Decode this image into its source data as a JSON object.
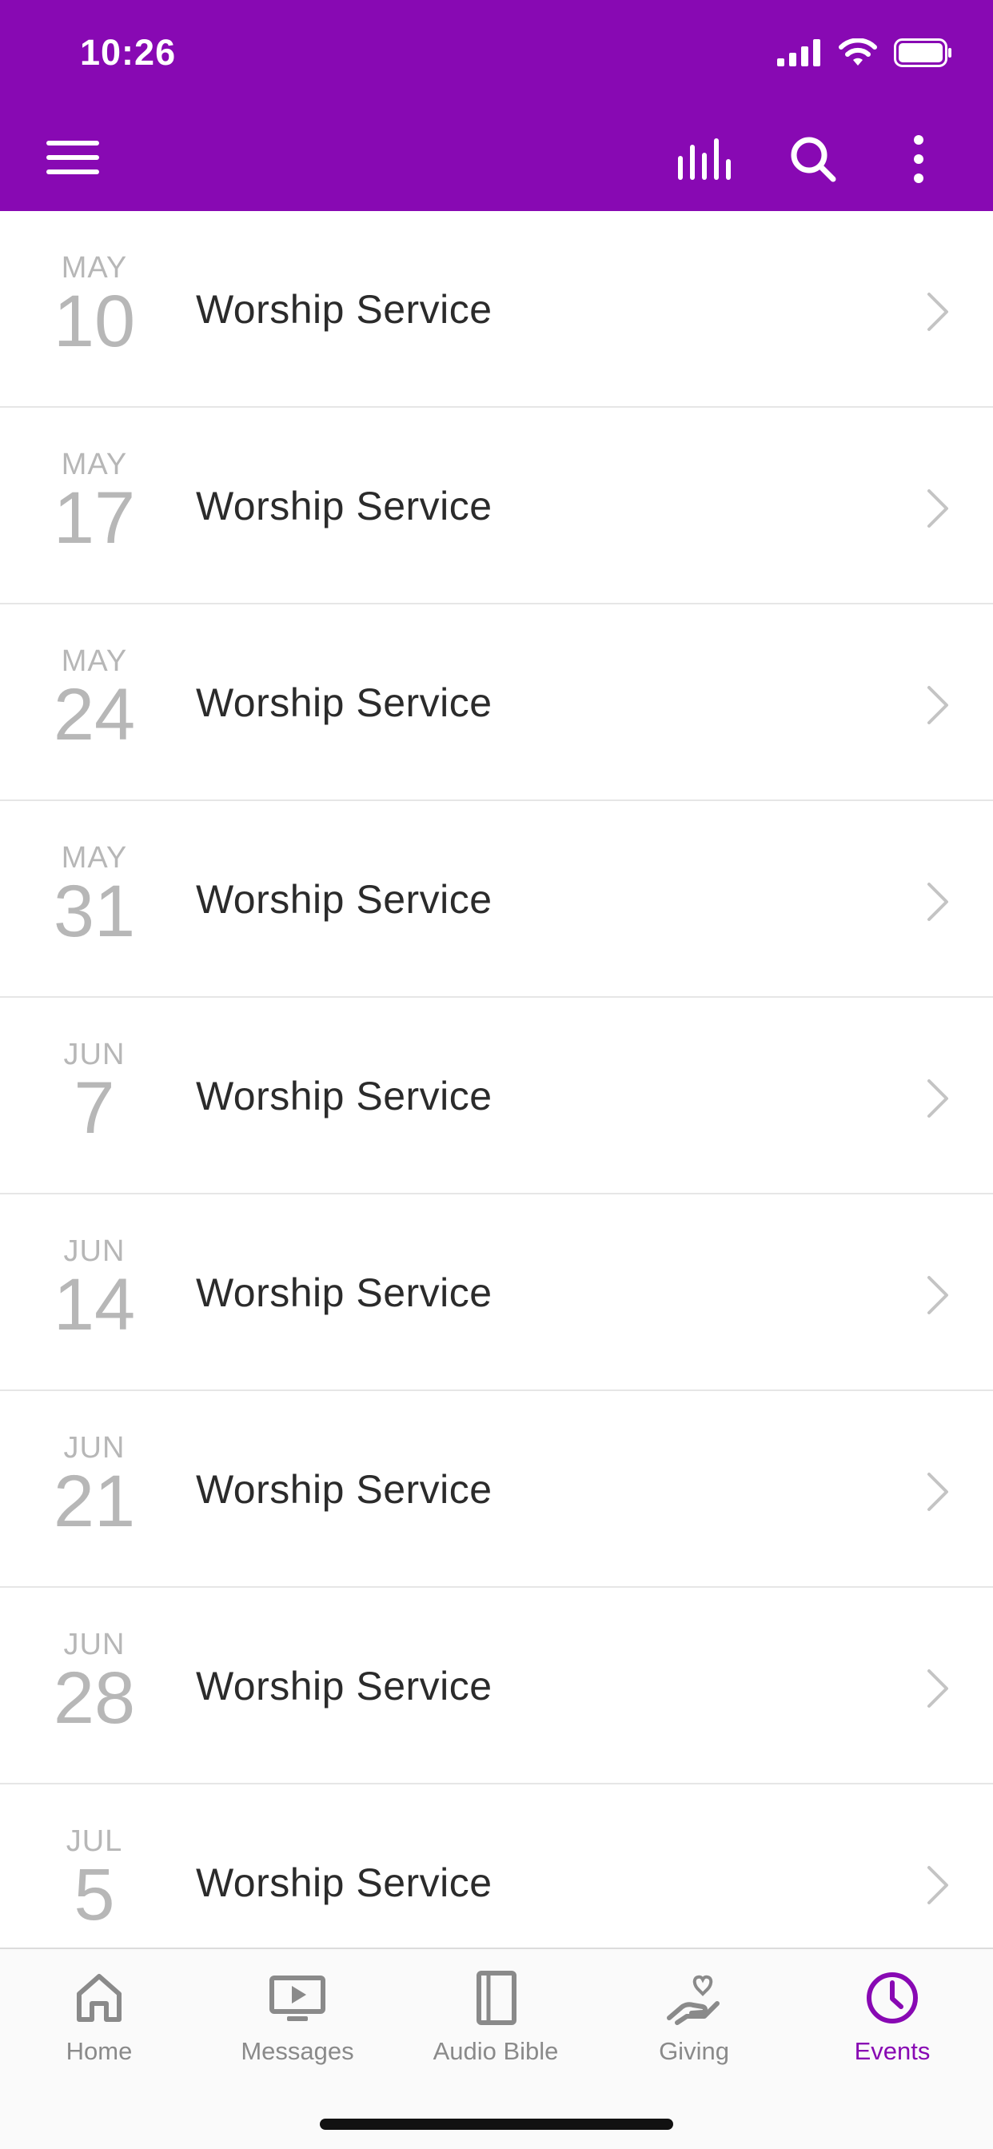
{
  "status_bar": {
    "time": "10:26"
  },
  "colors": {
    "brand": "#8809b3",
    "date_text": "#b7b7b7",
    "title_text": "#2b2b2b",
    "tab_inactive": "#8a8a8a"
  },
  "events": [
    {
      "month": "MAY",
      "day": "10",
      "title": "Worship Service"
    },
    {
      "month": "MAY",
      "day": "17",
      "title": "Worship Service"
    },
    {
      "month": "MAY",
      "day": "24",
      "title": "Worship Service"
    },
    {
      "month": "MAY",
      "day": "31",
      "title": "Worship Service"
    },
    {
      "month": "JUN",
      "day": "7",
      "title": "Worship Service"
    },
    {
      "month": "JUN",
      "day": "14",
      "title": "Worship Service"
    },
    {
      "month": "JUN",
      "day": "21",
      "title": "Worship Service"
    },
    {
      "month": "JUN",
      "day": "28",
      "title": "Worship Service"
    },
    {
      "month": "JUL",
      "day": "5",
      "title": "Worship Service"
    }
  ],
  "tabs": [
    {
      "label": "Home",
      "icon": "home-icon"
    },
    {
      "label": "Messages",
      "icon": "video-icon"
    },
    {
      "label": "Audio Bible",
      "icon": "book-icon"
    },
    {
      "label": "Giving",
      "icon": "giving-hand-icon"
    },
    {
      "label": "Events",
      "icon": "clock-icon"
    }
  ]
}
